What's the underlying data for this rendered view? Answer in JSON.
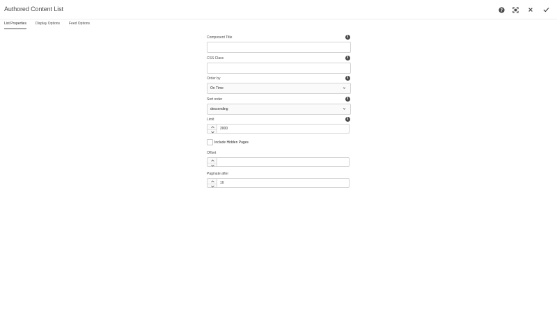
{
  "dialog": {
    "title": "Authored Content List",
    "actions": {
      "help_icon": "help-icon",
      "fullscreen_icon": "fullscreen-icon",
      "close_icon": "close-icon",
      "done_icon": "checkmark-icon"
    }
  },
  "tabs": [
    {
      "label": "List Properties",
      "active": true
    },
    {
      "label": "Display Options",
      "active": false
    },
    {
      "label": "Feed Options",
      "active": false
    }
  ],
  "fields": {
    "component_title": {
      "label": "Component Title",
      "value": ""
    },
    "css_class": {
      "label": "CSS Class",
      "value": ""
    },
    "order_by": {
      "label": "Order by",
      "value": "On Time"
    },
    "sort_order": {
      "label": "Sort order",
      "value": "descending"
    },
    "limit": {
      "label": "Limit",
      "value": "2000"
    },
    "include_hidden": {
      "label": "Include Hidden Pages",
      "checked": false
    },
    "offset": {
      "label": "Offset",
      "value": ""
    },
    "paginate_after": {
      "label": "Paginate after",
      "value": "10"
    }
  },
  "colors": {
    "text": "#4b4b4b",
    "border": "#d4d4d4",
    "icon": "#4b4b4b"
  }
}
